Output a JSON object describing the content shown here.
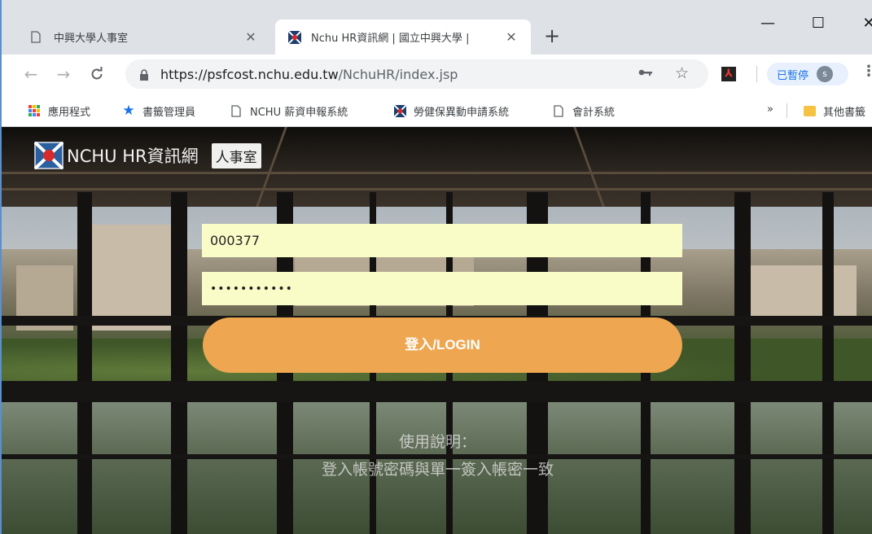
{
  "browser": {
    "tabs": [
      {
        "title": "中興大學人事室",
        "active": false
      },
      {
        "title": "Nchu HR資訊網 | 國立中興大學 |",
        "active": true
      }
    ],
    "new_tab_label": "+",
    "window_controls": {
      "minimize": "—",
      "maximize": "☐",
      "close": "✕"
    },
    "url_host": "https://psfcost.nchu.edu.tw",
    "url_path": "/NchuHR/index.jsp",
    "profile_chip_label": "已暫停",
    "profile_initial": "s",
    "bookmarks": [
      {
        "label": "應用程式",
        "icon": "apps-grid-icon"
      },
      {
        "label": "書籤管理員",
        "icon": "star-icon"
      },
      {
        "label": "NCHU 薪資申報系統",
        "icon": "page-icon"
      },
      {
        "label": "勞健保異動申請系統",
        "icon": "nchu-favicon"
      },
      {
        "label": "會計系統",
        "icon": "page-icon"
      }
    ],
    "bookmarks_more": "»",
    "other_bookmarks": "其他書籤"
  },
  "page": {
    "logo_text": "NCHU HR資訊網",
    "badge": "人事室",
    "username_value": "000377",
    "password_value": "•••••••••••",
    "login_label": "登入/LOGIN",
    "usage_title": "使用說明：",
    "usage_text": "登入帳號密碼與單一簽入帳密一致"
  },
  "colors": {
    "accent_button": "#eea650",
    "input_bg": "#fafcc8",
    "chip_text": "#1a73e8"
  }
}
